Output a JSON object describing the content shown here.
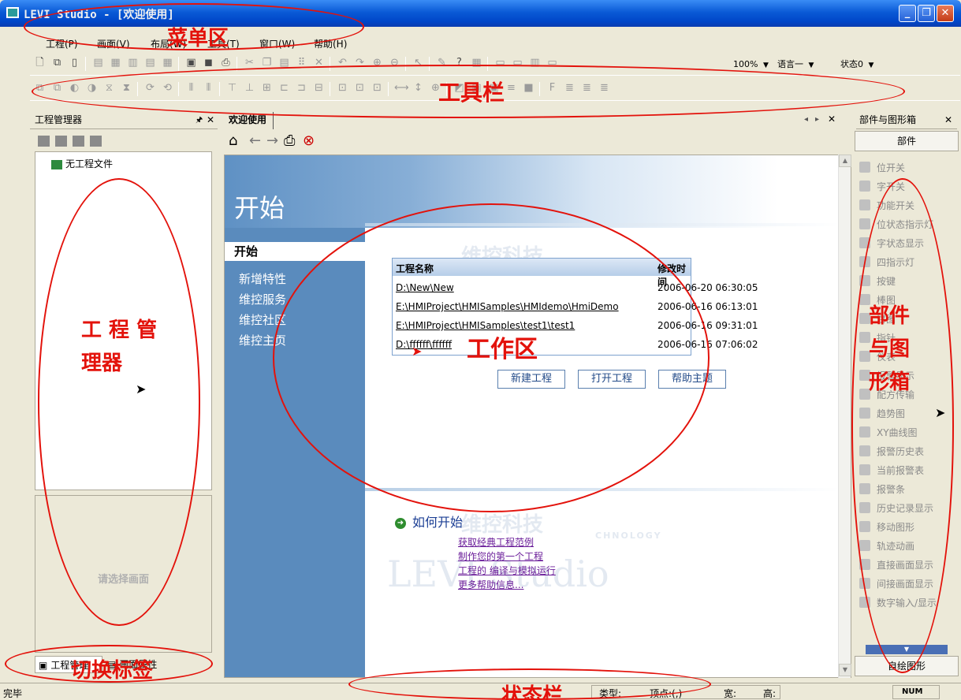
{
  "window": {
    "title": "LEVI Studio - [欢迎使用]"
  },
  "menu": [
    "工程(P)",
    "画面(V)",
    "布局(W)",
    "工具(T)",
    "窗口(W)",
    "帮助(H)"
  ],
  "toolbar": {
    "zoom": "100%",
    "language": "语言一",
    "state": "状态0"
  },
  "left_panel": {
    "title": "工程管理器",
    "tree_root": "无工程文件",
    "props_hint": "请选择画面",
    "tabs": [
      "工程管理",
      "画面属性"
    ]
  },
  "doc": {
    "tab_label": "欢迎使用",
    "hero_title": "开始",
    "nav": [
      "开始",
      "新增特性",
      "维控服务",
      "维控社区",
      "维控主页"
    ],
    "watermark_brand": "维控科技",
    "watermark_product": "LEVI Studio",
    "watermark_tech": "CHNOLOGY",
    "table_headers": [
      "工程名称",
      "修改时间"
    ],
    "projects": [
      {
        "name": "D:\\New\\New",
        "time": "2006-06-20 06:30:05"
      },
      {
        "name": "E:\\HMIProject\\HMISamples\\HMIdemo\\HmiDemo",
        "time": "2006-06-16 06:13:01"
      },
      {
        "name": "E:\\HMIProject\\HMISamples\\test1\\test1",
        "time": "2006-06-16 09:31:01"
      },
      {
        "name": "D:\\ffffff\\ffffff",
        "time": "2006-06-16 07:06:02"
      }
    ],
    "buttons": [
      "新建工程",
      "打开工程",
      "帮助主题"
    ],
    "howto_title": "如何开始",
    "howto_links": [
      "获取经典工程范例",
      "制作您的第一个工程",
      "工程的 编译与模拟运行",
      "更多帮助信息..."
    ]
  },
  "right_panel": {
    "title": "部件与图形箱",
    "section": "部件",
    "items": [
      "位开关",
      "字开关",
      "功能开关",
      "位状态指示灯",
      "字状态显示",
      "四指示灯",
      "按键",
      "棒图",
      "饼图",
      "指针",
      "仪表",
      "报警显示",
      "配方传输",
      "趋势图",
      "XY曲线图",
      "报警历史表",
      "当前报警表",
      "报警条",
      "历史记录显示",
      "移动图形",
      "轨迹动画",
      "直接画面显示",
      "间接画面显示",
      "数字输入/显示"
    ],
    "footer": "自绘图形"
  },
  "statusbar": {
    "left": "完毕",
    "type_label": "类型:",
    "vertex_label": "顶点:(,)",
    "width_label": "宽:",
    "height_label": "高:",
    "num": "NUM"
  },
  "annotations": {
    "menubar": "菜单区",
    "toolbar": "工具栏",
    "project_manager_1": "工 程 管",
    "project_manager_2": "理器",
    "workspace": "工作区",
    "parts_1": "部件",
    "parts_2": "与图",
    "parts_3": "形箱",
    "switch_tabs": "切换标签",
    "statusbar": "状态栏"
  },
  "colors": {
    "annotation": "#e3120b",
    "title_bar": "#0a5ad6",
    "nav_panel": "#5a8bbd"
  }
}
